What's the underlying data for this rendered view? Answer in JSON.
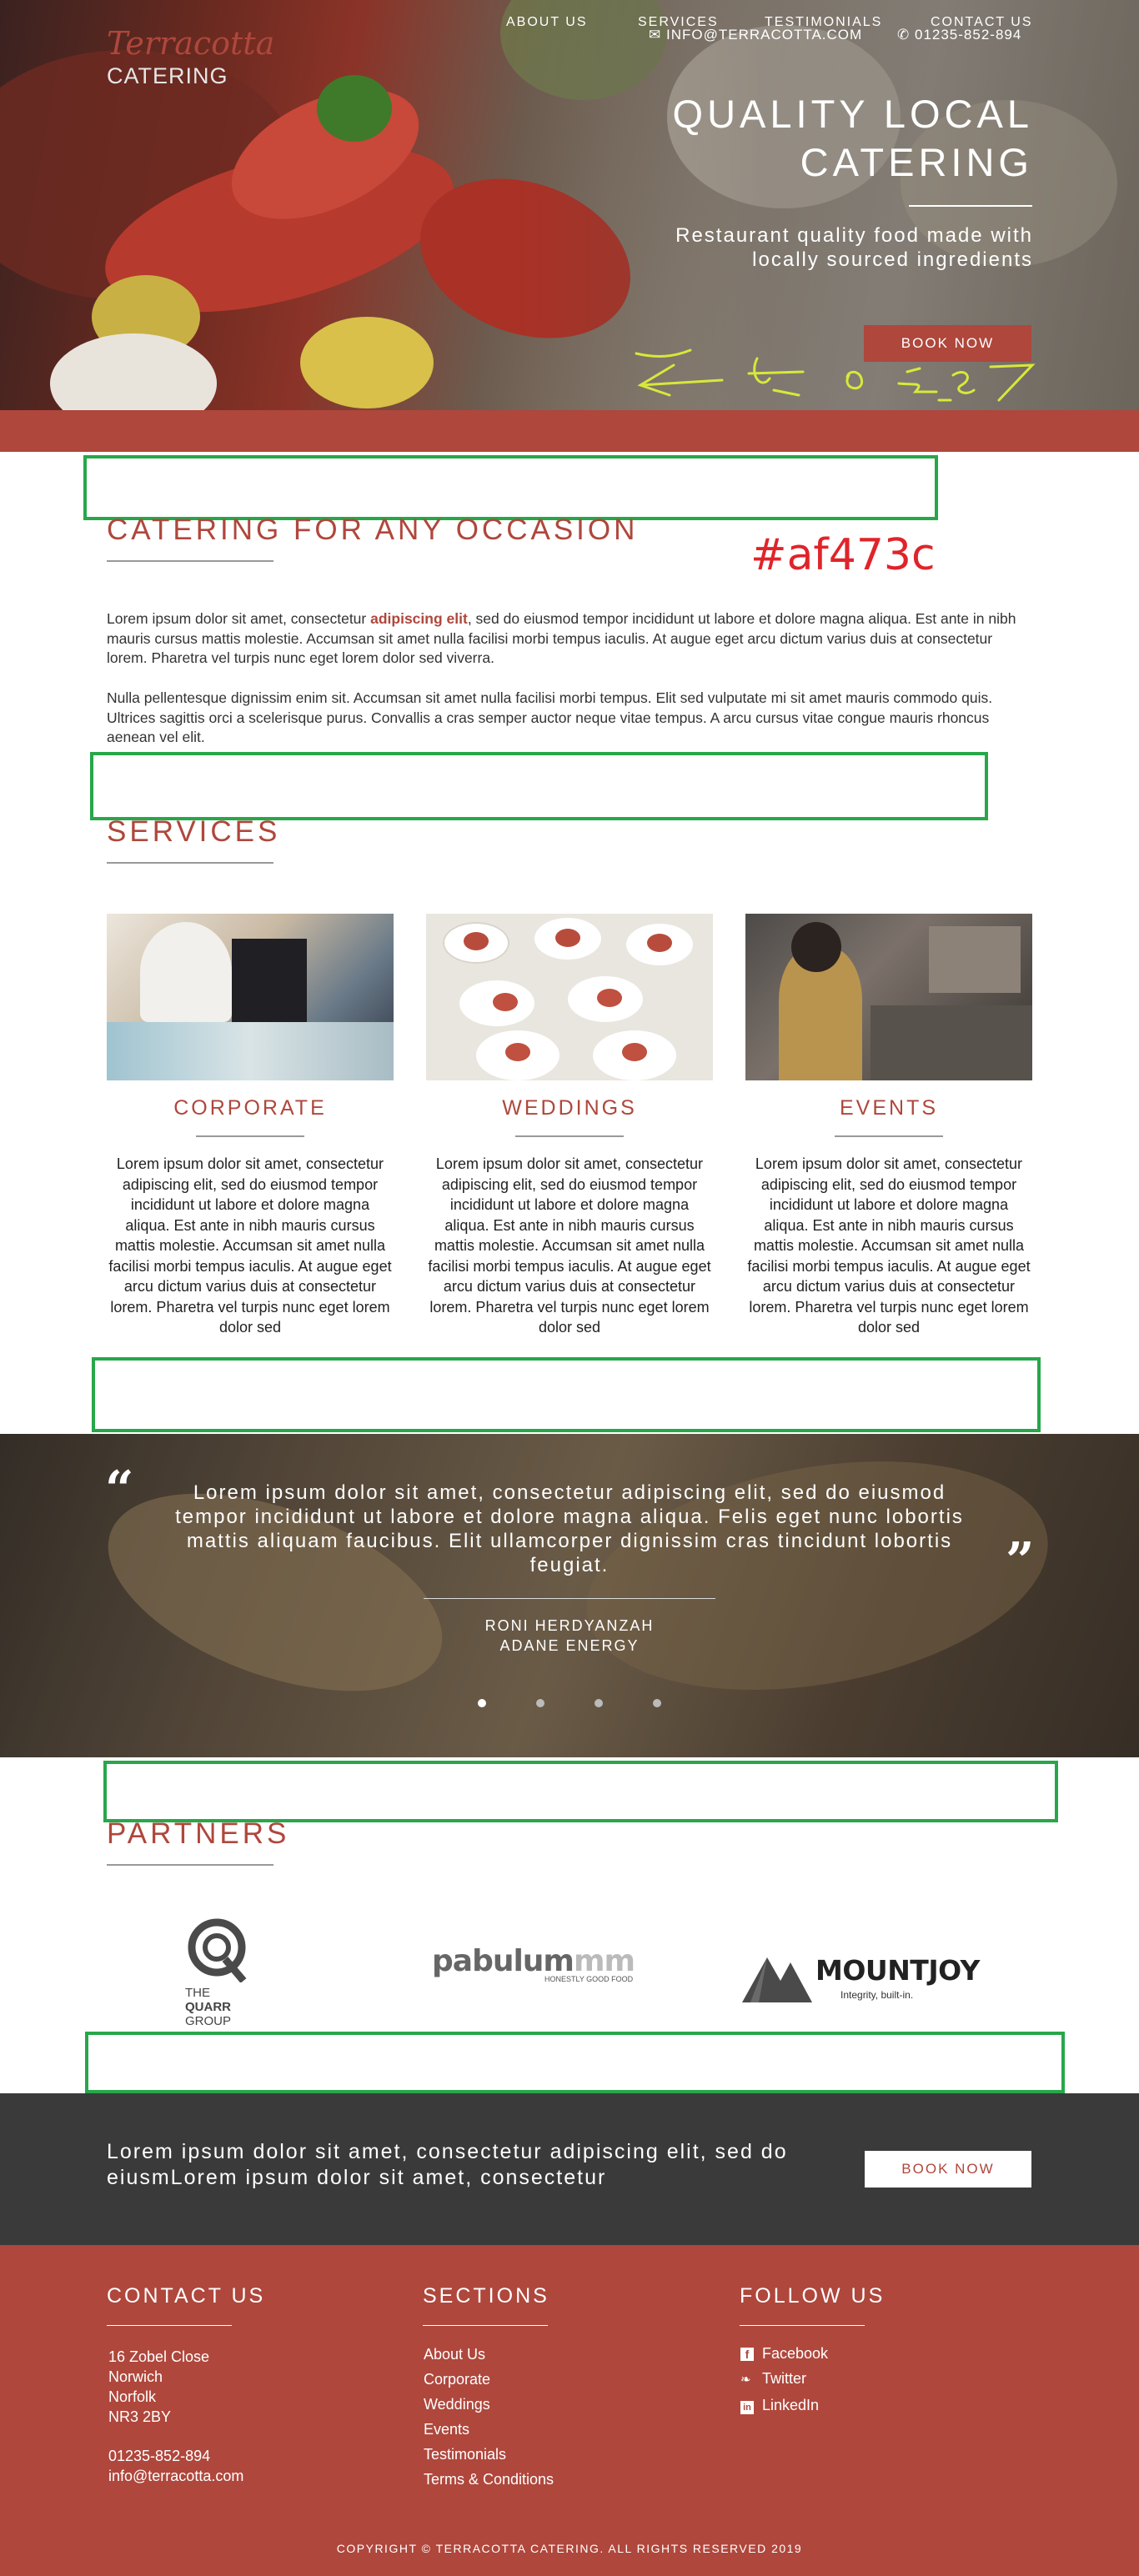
{
  "header": {
    "logo_script": "Terracotta",
    "logo_sub": "CATERING",
    "email": "INFO@TERRACOTTA.COM",
    "phone": "01235-852-894",
    "hero_title": "QUALITY LOCAL CATERING",
    "hero_subtitle": "Restaurant quality food made with locally sourced ingredients",
    "book_now": "BOOK NOW"
  },
  "nav": {
    "items": [
      {
        "label": "ABOUT US"
      },
      {
        "label": "SERVICES"
      },
      {
        "label": "TESTIMONIALS"
      },
      {
        "label": "CONTACT US"
      }
    ]
  },
  "annotation": {
    "hex_label": "#af473c"
  },
  "about": {
    "title": "CATERING FOR ANY OCCASION",
    "para1_before": "Lorem ipsum dolor sit amet, consectetur ",
    "para1_bold": "adipiscing elit",
    "para1_after": ", sed do eiusmod tempor incididunt ut labore et dolore magna aliqua. Est ante in nibh mauris cursus mattis molestie. Accumsan sit amet nulla facilisi morbi tempus iaculis. At augue eget arcu dictum varius duis at consectetur lorem. Pharetra vel turpis nunc eget lorem dolor sed viverra.",
    "para2": "Nulla pellentesque dignissim enim sit. Accumsan sit amet nulla facilisi morbi tempus. Elit sed vulputate mi sit amet mauris commodo quis. Ultrices sagittis orci a scelerisque purus. Convallis a cras semper auctor neque vitae tempus. A arcu cursus vitae congue mauris rhoncus aenean vel elit."
  },
  "services": {
    "title": "SERVICES",
    "items": [
      {
        "title": "CORPORATE",
        "text": "Lorem ipsum dolor sit amet, consectetur adipiscing elit, sed do eiusmod tempor incididunt ut labore et dolore magna aliqua. Est ante in nibh mauris cursus mattis molestie. Accumsan sit amet nulla facilisi morbi tempus iaculis. At augue eget arcu dictum varius duis at consectetur lorem. Pharetra vel turpis nunc eget lorem dolor sed"
      },
      {
        "title": "WEDDINGS",
        "text": "Lorem ipsum dolor sit amet, consectetur adipiscing elit, sed do eiusmod tempor incididunt ut labore et dolore magna aliqua. Est ante in nibh mauris cursus mattis molestie. Accumsan sit amet nulla facilisi morbi tempus iaculis. At augue eget arcu dictum varius duis at consectetur lorem. Pharetra vel turpis nunc eget lorem dolor sed"
      },
      {
        "title": "EVENTS",
        "text": "Lorem ipsum dolor sit amet, consectetur adipiscing elit, sed do eiusmod tempor incididunt ut labore et dolore magna aliqua. Est ante in nibh mauris cursus mattis molestie. Accumsan sit amet nulla facilisi morbi tempus iaculis. At augue eget arcu dictum varius duis at consectetur lorem. Pharetra vel turpis nunc eget lorem dolor sed"
      }
    ]
  },
  "testimonial": {
    "quote": "Lorem ipsum dolor sit amet, consectetur adipiscing elit, sed do eiusmod tempor incididunt ut labore et dolore magna aliqua. Felis eget nunc lobortis mattis aliquam faucibus. Elit ullamcorper dignissim cras tincidunt lobortis feugiat.",
    "name": "RONI HERDYANZAH",
    "company": "ADANE ENERGY",
    "open_quote": "“",
    "close_quote": "”"
  },
  "partners": {
    "title": "PARTNERS",
    "quarr_line1": "THE",
    "quarr_line2": "QUARR",
    "quarr_line3": "GROUP",
    "pabulum_main": "pabulum",
    "pabulum_fade": "mm",
    "pabulum_tag": "HONESTLY GOOD FOOD",
    "mountjoy_name": "MOUNTJOY",
    "mountjoy_tag": "Integrity, built-in."
  },
  "cta": {
    "text": "Lorem ipsum dolor sit amet, consectetur adipiscing elit, sed do eiusmLorem ipsum dolor sit amet, consectetur",
    "button": "BOOK NOW"
  },
  "footer": {
    "contact_title": "CONTACT US",
    "address": [
      "16 Zobel Close",
      "Norwich",
      "Norfolk",
      "NR3 2BY"
    ],
    "phone": "01235-852-894",
    "email": "info@terracotta.com",
    "sections_title": "SECTIONS",
    "sections": [
      "About Us",
      "Corporate",
      "Weddings",
      "Events",
      "Testimonials",
      "Terms & Conditions"
    ],
    "follow_title": "FOLLOW US",
    "social": [
      "Facebook",
      "Twitter",
      "LinkedIn"
    ],
    "copyright": "COPYRIGHT © TERRACOTTA CATERING. ALL RIGHTS RESERVED 2019"
  },
  "colors": {
    "brand": "#af473c",
    "annotation_green": "#27a74a",
    "dark_band": "#3a3a3a"
  }
}
